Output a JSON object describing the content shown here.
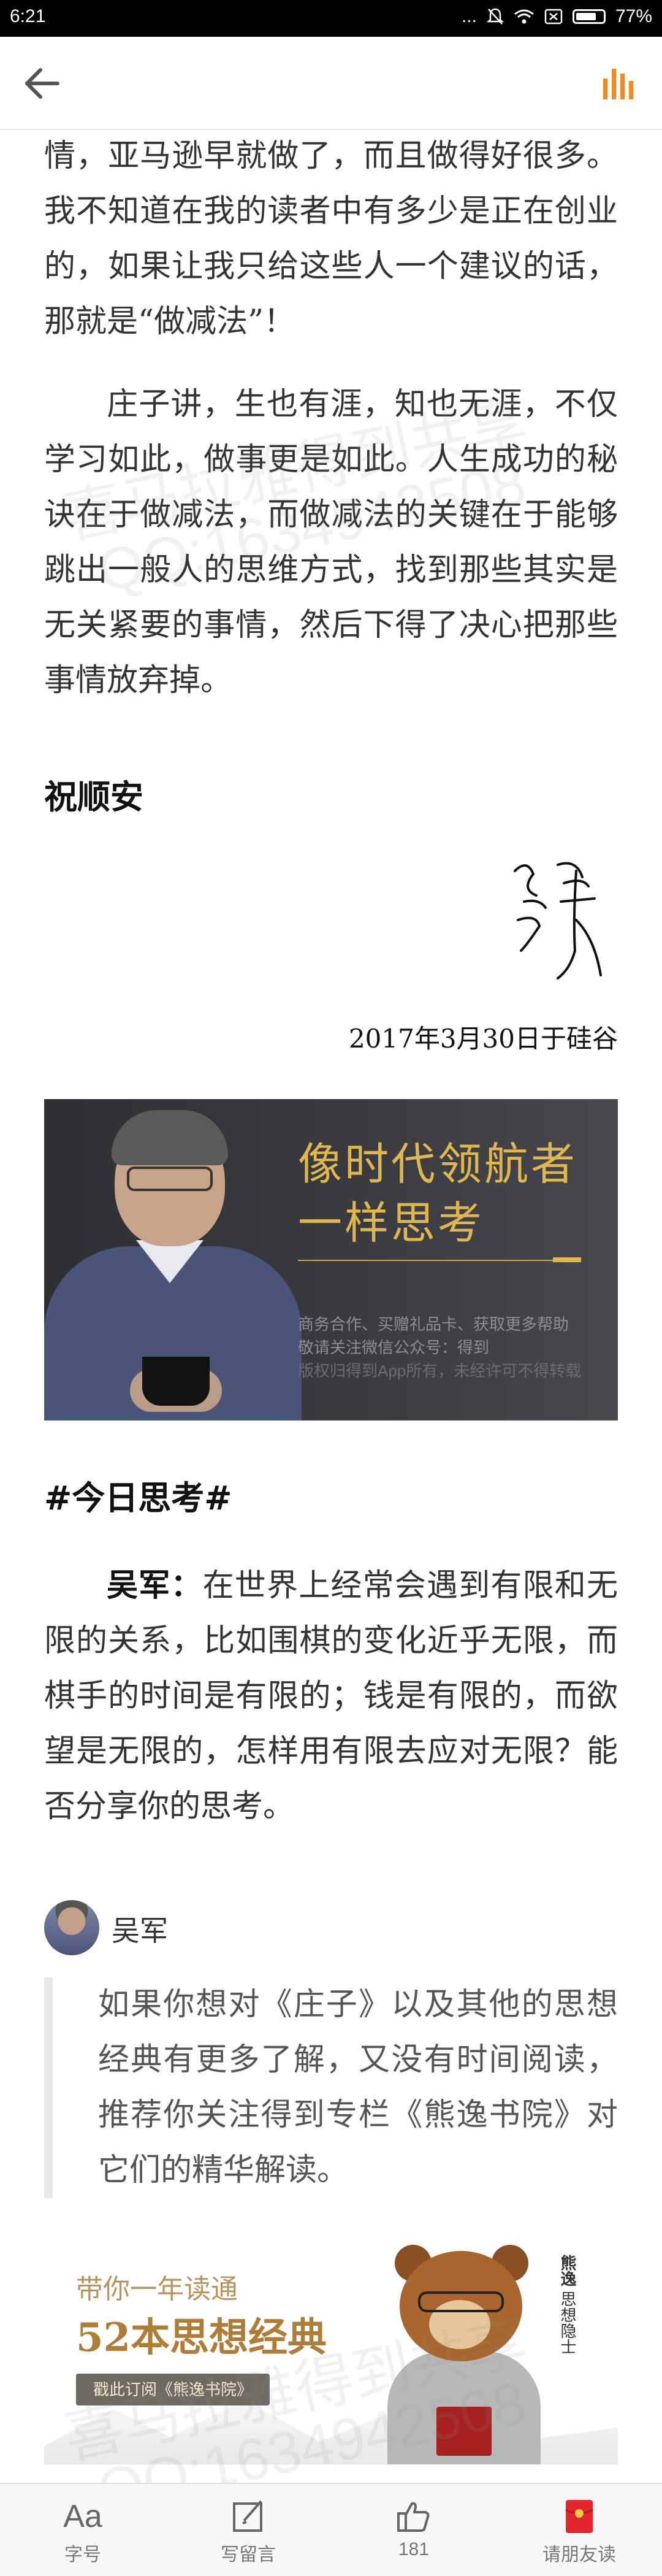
{
  "status_bar": {
    "time": "6:21",
    "dots": "...",
    "battery": "77%",
    "battery_level": 0.77
  },
  "app_bar": {
    "back_icon": "arrow-left-icon",
    "audio_icon": "audio-bars-icon",
    "accent_color": "#f08a24"
  },
  "article": {
    "paragraphs": [
      "情，亚马逊早就做了，而且做得好很多。我不知道在我的读者中有多少是正在创业的，如果让我只给这些人一个建议的话，那就是“做减法”！",
      "庄子讲，生也有涯，知也无涯，不仅学习如此，做事更是如此。人生成功的秘诀在于做减法，而做减法的关键在于能够跳出一般人的思维方式，找到那些其实是无关紧要的事情，然后下得了决心把那些事情放弃掉。"
    ],
    "greeting": "祝顺安",
    "signature_icon": "handwritten-signature",
    "date_line": "2017年3月30日于硅谷"
  },
  "banner": {
    "title_line1": "像时代领航者",
    "title_line2": "一样思考",
    "info_line1": "商务合作、买赠礼品卡、获取更多帮助",
    "info_line2": "敬请关注微信公众号：得到",
    "info_line3": "版权归得到App所有，未经许可不得转载",
    "title_color": "#e0b64f"
  },
  "daily_thinking": {
    "heading": "#今日思考#",
    "author": "吴军：",
    "question": "在世界上经常会遇到有限和无限的关系，比如围棋的变化近乎无限，而棋手的时间是有限的；钱是有限的，而欲望是无限的，怎样用有限去应对无限？能否分享你的思考。"
  },
  "comment": {
    "name": "吴军",
    "text": "如果你想对《庄子》以及其他的思想经典有更多了解，又没有时间阅读，推荐你关注得到专栏《熊逸书院》对它们的精华解读。"
  },
  "promo": {
    "line1": "带你一年读通",
    "line2": "52本思想经典",
    "button": "戳此订阅《熊逸书院》",
    "vertical_bold": "熊逸",
    "vertical_sub": "思想隐士"
  },
  "watermarks": [
    "喜马拉雅得到共享",
    "QQ:1634942508",
    "喜马拉雅得到共享",
    "QQ:1634942508"
  ],
  "bottom_bar": {
    "font_glyph": "Aa",
    "tabs": [
      {
        "label": "字号",
        "icon": "font-size-icon"
      },
      {
        "label": "写留言",
        "icon": "compose-icon"
      },
      {
        "label": "181",
        "icon": "thumbs-up-icon"
      },
      {
        "label": "请朋友读",
        "icon": "red-envelope-icon"
      }
    ]
  }
}
